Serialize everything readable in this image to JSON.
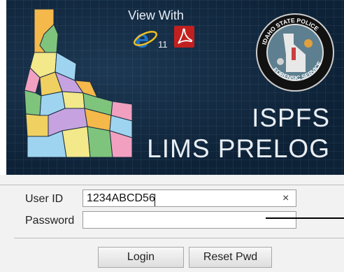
{
  "banner": {
    "view_with": "View With",
    "ie_version": "11",
    "title_line1": "ISPFS",
    "title_line2": "LIMS PRELOG",
    "seal_text_top": "IDAHO STATE POLICE",
    "seal_text_bottom": "FORENSIC SERVICES",
    "colors": {
      "background": "#0d2237",
      "title": "#e9eef4",
      "pdf_red": "#c21f1f",
      "ie_blue": "#1e73c7"
    }
  },
  "form": {
    "userid_label": "User ID",
    "userid_value": "1234ABCD56",
    "clear_symbol": "×",
    "password_label": "Password",
    "password_value": "",
    "login_label": "Login",
    "reset_label": "Reset Pwd"
  }
}
